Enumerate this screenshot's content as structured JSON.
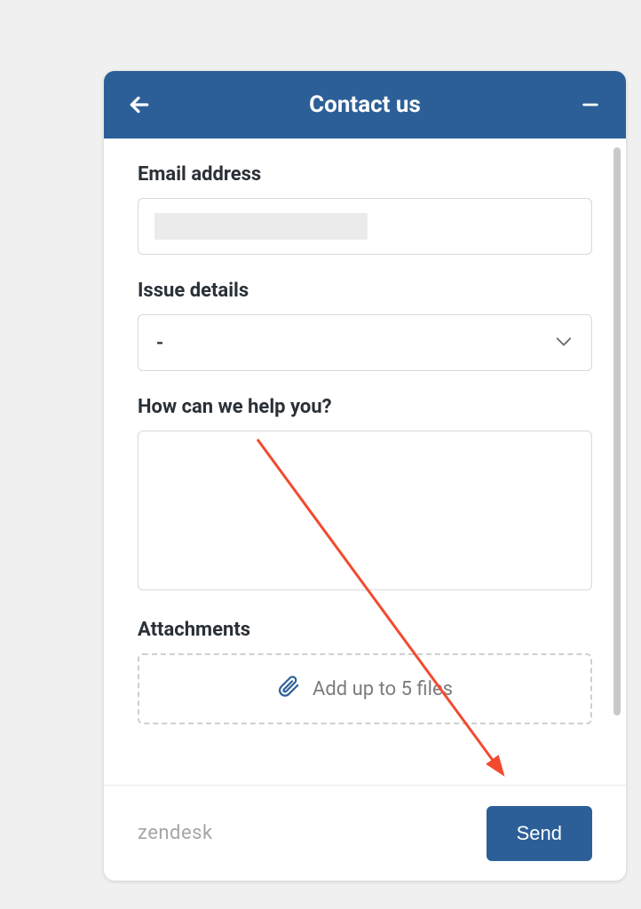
{
  "header": {
    "title": "Contact us"
  },
  "form": {
    "email_label": "Email address",
    "email_value": "",
    "issue_label": "Issue details",
    "issue_selected": "-",
    "help_label": "How can we help you?",
    "help_value": "",
    "attachments_label": "Attachments",
    "attachments_hint": "Add up to 5 files"
  },
  "footer": {
    "brand": "zendesk",
    "send_label": "Send"
  },
  "colors": {
    "header_bg": "#2c5f98",
    "text_dark": "#2a3037",
    "border": "#d8d8d8",
    "annotation_arrow": "#f24a2e"
  }
}
